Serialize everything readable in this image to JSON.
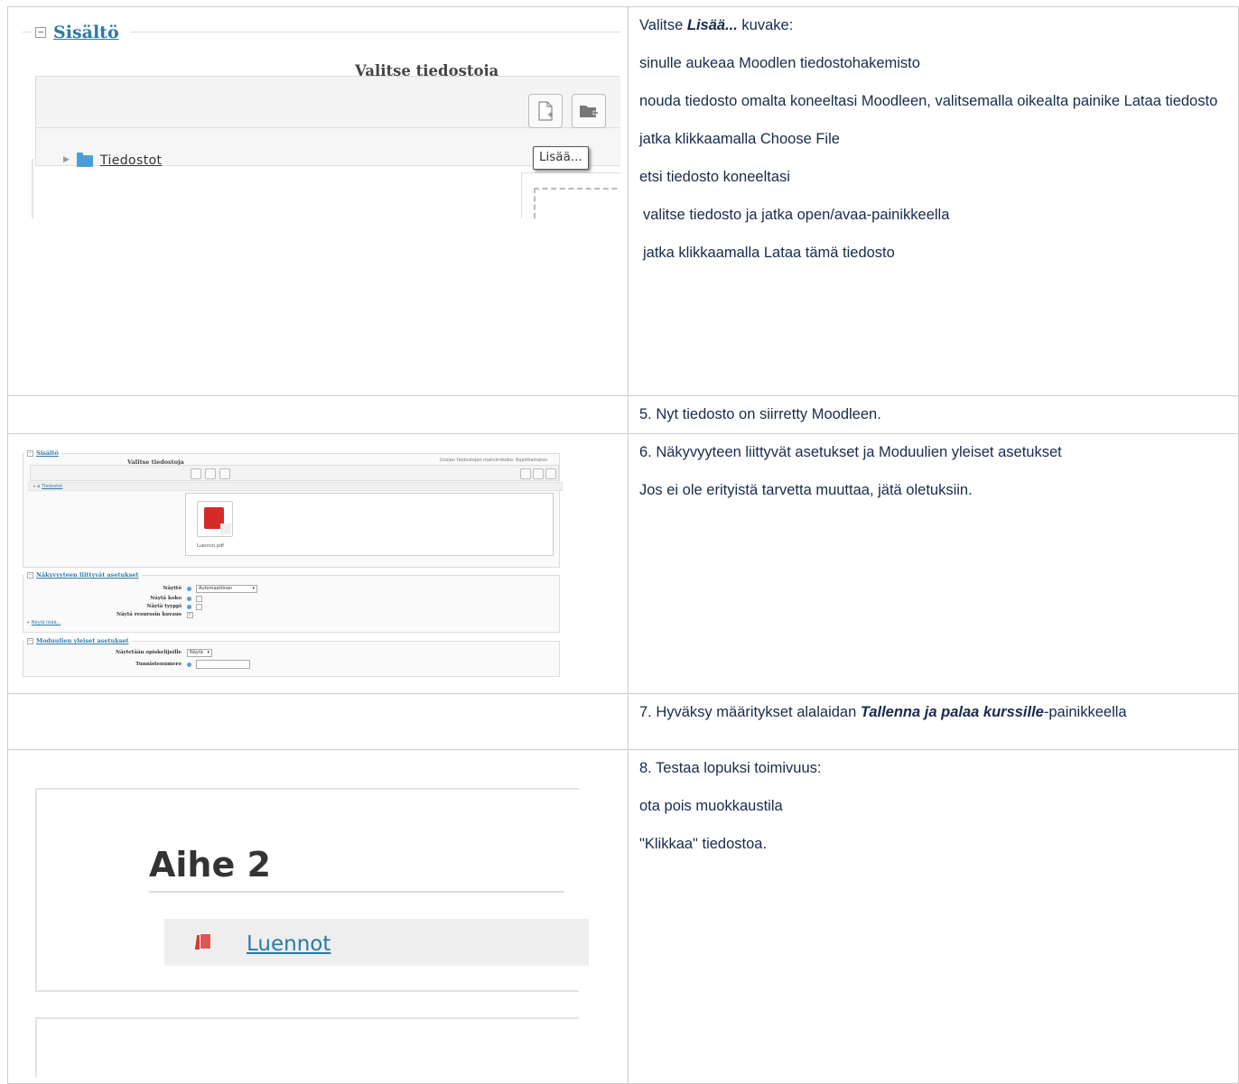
{
  "rows": [
    {
      "screenshot": {
        "legend": "Sisältö",
        "title": "Valitse tiedostoja",
        "tree_item": "Tiedostot",
        "tooltip": "Lisää..."
      },
      "paragraphs": {
        "p1_prefix": "Valitse ",
        "p1_bold": "Lisää...",
        "p1_suffix": " kuvake:",
        "p2": "sinulle aukeaa Moodlen tiedostohakemisto",
        "p3": "nouda tiedosto omalta koneeltasi Moodleen, valitsemalla oikealta painike Lataa tiedosto",
        "p4": "jatka klikkaamalla Choose File",
        "p5": "etsi tiedosto koneeltasi",
        "p6": "valitse tiedosto ja jatka open/avaa-painikkeella",
        "p7": "jatka klikkaamalla Lataa tämä tiedosto"
      }
    },
    {
      "text": "5. Nyt tiedosto on siirretty Moodleen."
    },
    {
      "screenshot": {
        "legend1": "Sisältö",
        "title": "Valitse tiedostoja",
        "right_note": "Uusien tiedostojen maksimikoko: Rajoittamaton",
        "tree_item": "Tiedostot",
        "file_name": "Luennot.pdf",
        "legend2": "Näkyvyyteen liittyvät asetukset",
        "naytto_label": "Näyttö",
        "naytto_value": "Automaattinen",
        "koko_label": "Näytä koko",
        "tyyppi_label": "Näytä tyyppi",
        "kuvaus_label": "Näytä resurssin kuvaus",
        "show_more": "Näytä lisää...",
        "legend3": "Moduulien yleiset asetukset",
        "opiskelijoille_label": "Näytetään opiskelijoille",
        "opiskelijoille_value": "Näytä",
        "tunniste_label": "Tunnistenumero"
      },
      "p1": "6. Näkyvyyteen liittyvät asetukset ja Moduulien yleiset asetukset",
      "p2": "Jos ei ole erityistä tarvetta muuttaa, jätä oletuksiin."
    },
    {
      "prefix": "7. Hyväksy määritykset alalaidan ",
      "bold": "Tallenna ja palaa kurssille",
      "suffix": "-painikkeella"
    },
    {
      "screenshot": {
        "heading": "Aihe 2",
        "link": "Luennot"
      },
      "p1": "8. Testaa lopuksi toimivuus:",
      "p2": "ota pois muokkaustila",
      "p3": "\"Klikkaa\" tiedostoa."
    }
  ],
  "colors": {
    "link": "#2a7aa7",
    "pdf_red": "#d62a2a",
    "border": "#cccccc",
    "text": "#172b4d"
  }
}
